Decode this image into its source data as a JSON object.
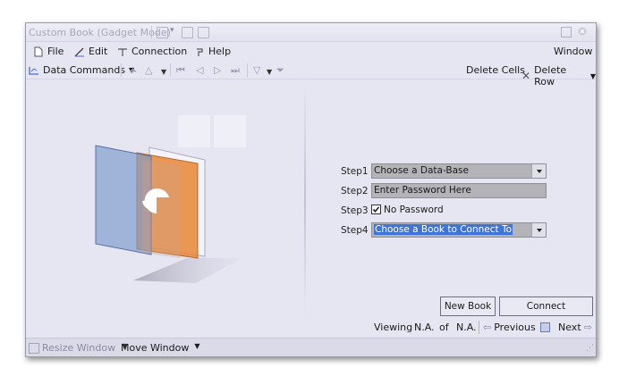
{
  "window": {
    "title": "Custom Book (Gadget Mode)"
  },
  "menu": {
    "file": "File",
    "edit": "Edit",
    "connection": "Connection",
    "help": "Help",
    "window": "Window"
  },
  "toolbar": {
    "data_commands": "Data Commands",
    "delete_cells": "Delete Cells",
    "delete_row": "Delete Row"
  },
  "steps": {
    "step1_label": "Step1",
    "step1_value": "Choose a Data-Base",
    "step2_label": "Step2",
    "step2_placeholder": "Enter Password Here",
    "step3_label": "Step3",
    "step3_checkbox_label": "No Password",
    "step3_checked": true,
    "step4_label": "Step4",
    "step4_value": "Choose a Book to Connect To"
  },
  "buttons": {
    "new_book": "New Book",
    "connect": "Connect"
  },
  "navigation": {
    "viewing": "Viewing",
    "current": "N.A.",
    "of": "of",
    "total": "N.A.",
    "previous": "Previous",
    "next": "Next"
  },
  "status": {
    "resize_window": "Resize Window",
    "move_window": "Move Window"
  },
  "colors": {
    "window_bg": "#e6e6f3",
    "field_bg": "#b4b4b8",
    "selection": "#3e73d8",
    "front_panel": "#7f9bcb",
    "back_panel": "#e88a3c"
  },
  "icons": {
    "file": "file-icon",
    "edit": "pencil-icon",
    "connection": "connection-icon",
    "help": "help-icon",
    "delete": "x-icon",
    "previous": "arrow-left-icon",
    "next": "arrow-right-icon"
  }
}
